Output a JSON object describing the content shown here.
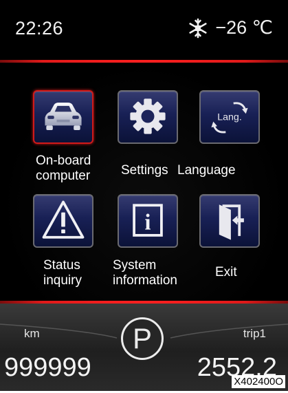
{
  "status": {
    "time": "22:26",
    "temperature": "−26 ℃",
    "weather_icon": "snowflake-icon"
  },
  "menu": {
    "items": [
      {
        "id": "onboard",
        "label_line1": "On-board",
        "label_line2": "computer",
        "icon": "car-icon",
        "selected": true
      },
      {
        "id": "settings",
        "label": "Settings",
        "icon": "gear-icon",
        "selected": false
      },
      {
        "id": "language",
        "label": "Language",
        "icon": "language-icon",
        "icon_text": "Lang.",
        "selected": false
      },
      {
        "id": "status",
        "label_line1": "Status",
        "label_line2": "inquiry",
        "icon": "warning-icon",
        "selected": false
      },
      {
        "id": "sysinfo",
        "label_line1": "System",
        "label_line2": "information",
        "icon": "info-icon",
        "icon_text": "i",
        "selected": false
      },
      {
        "id": "exit",
        "label": "Exit",
        "icon": "exit-door-icon",
        "selected": false
      }
    ]
  },
  "cluster": {
    "odometer_unit": "km",
    "odometer_value": "999999",
    "gear": "P",
    "trip_label": "trip1",
    "trip_value": "2552.2"
  },
  "figure_code": "X402400O",
  "colors": {
    "accent_red": "#e01a1a",
    "tile_blue": "#182055",
    "background": "#000000"
  }
}
